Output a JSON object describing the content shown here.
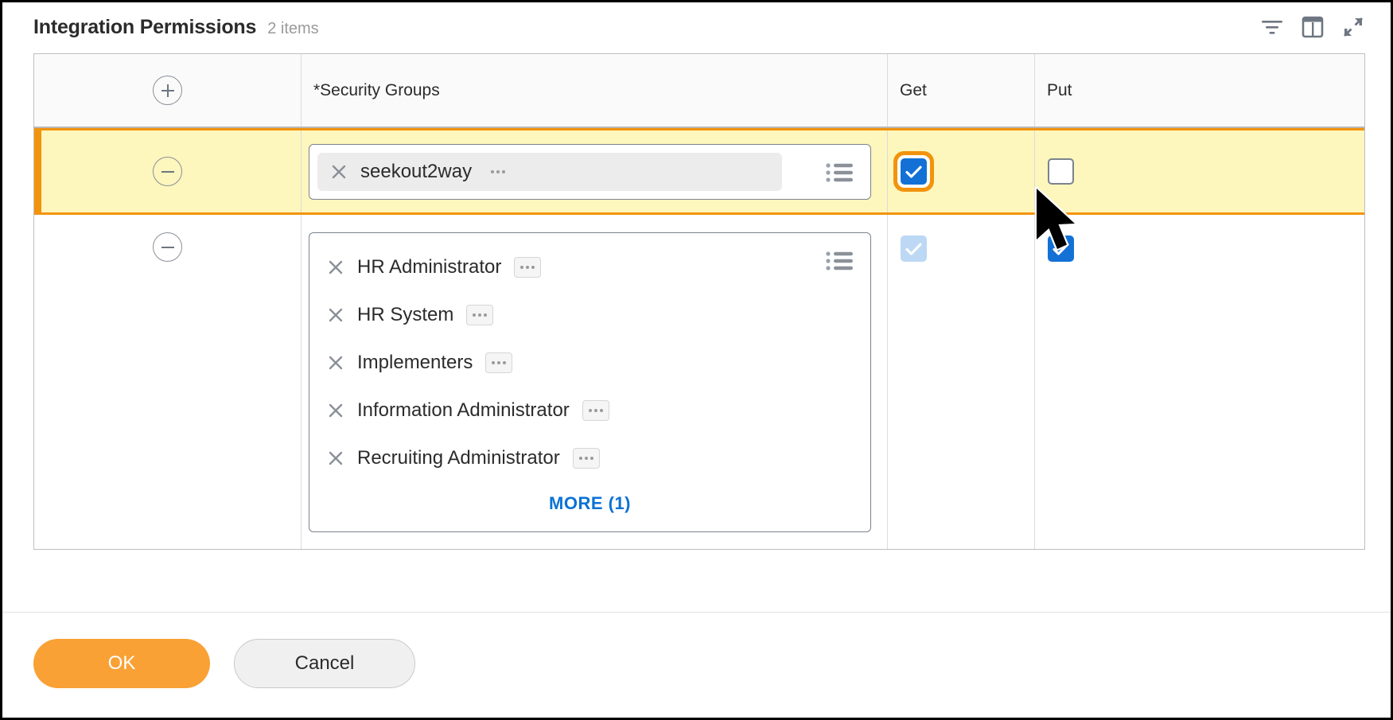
{
  "panel": {
    "title": "Integration Permissions",
    "count_label": "2 items"
  },
  "header_icons": [
    {
      "name": "filter-icon",
      "label": "Filter"
    },
    {
      "name": "table-view-icon",
      "label": "Table view"
    },
    {
      "name": "expand-icon",
      "label": "Expand"
    }
  ],
  "table": {
    "columns": [
      {
        "key": "handle",
        "label": ""
      },
      {
        "key": "groups",
        "label": "*Security Groups"
      },
      {
        "key": "get",
        "label": "Get"
      },
      {
        "key": "put",
        "label": "Put"
      }
    ],
    "add_button_label": "+",
    "rows": [
      {
        "selected": true,
        "remove_label": "−",
        "items": [
          {
            "label": "seekout2way",
            "menu_label": "···",
            "remove_label": "×"
          }
        ],
        "more_label": "",
        "get": {
          "state": "checked",
          "focused": true
        },
        "put": {
          "state": "unchecked",
          "focused": false
        }
      },
      {
        "selected": false,
        "remove_label": "−",
        "items": [
          {
            "label": "HR Administrator",
            "menu_label": "···",
            "remove_label": "×"
          },
          {
            "label": "HR System",
            "menu_label": "···",
            "remove_label": "×"
          },
          {
            "label": "Implementers",
            "menu_label": "···",
            "remove_label": "×"
          },
          {
            "label": "Information Administrator",
            "menu_label": "···",
            "remove_label": "×"
          },
          {
            "label": "Recruiting Administrator",
            "menu_label": "···",
            "remove_label": "×"
          }
        ],
        "more_label": "MORE (1)",
        "get": {
          "state": "checked-disabled",
          "focused": false
        },
        "put": {
          "state": "checked",
          "focused": false
        }
      }
    ]
  },
  "footer": {
    "ok_label": "OK",
    "cancel_label": "Cancel"
  },
  "colors": {
    "accent_orange": "#f2930d",
    "primary_button": "#f9a134",
    "checkbox_blue": "#1371d6",
    "checkbox_disabled_blue": "#bcd8f4",
    "link_blue": "#0a72d4",
    "row_highlight": "#fdf6bd"
  }
}
